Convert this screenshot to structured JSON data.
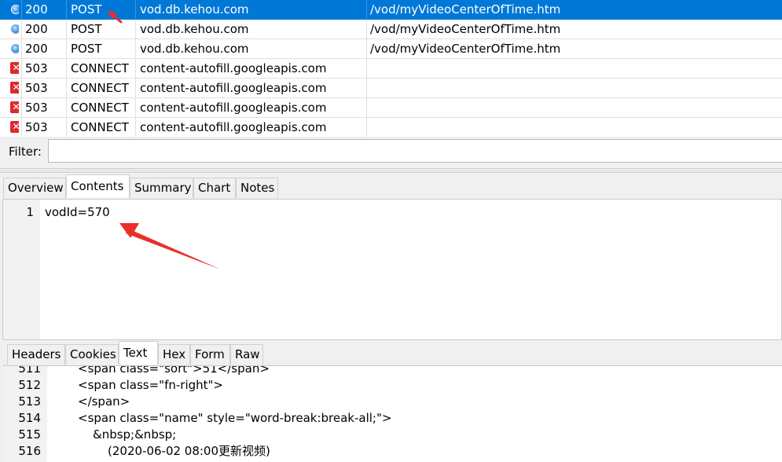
{
  "sessions": [
    {
      "icon": "globe-icon",
      "result": "200",
      "protocol": "POST",
      "host": "vod.db.kehou.com",
      "url": "/vod/myVideoCenterOfTime.htm",
      "selected": true
    },
    {
      "icon": "globe-icon",
      "result": "200",
      "protocol": "POST",
      "host": "vod.db.kehou.com",
      "url": "/vod/myVideoCenterOfTime.htm",
      "selected": false
    },
    {
      "icon": "globe-icon",
      "result": "200",
      "protocol": "POST",
      "host": "vod.db.kehou.com",
      "url": "/vod/myVideoCenterOfTime.htm",
      "selected": false
    },
    {
      "icon": "error-icon",
      "result": "503",
      "protocol": "CONNECT",
      "host": "content-autofill.googleapis.com",
      "url": "",
      "selected": false
    },
    {
      "icon": "error-icon",
      "result": "503",
      "protocol": "CONNECT",
      "host": "content-autofill.googleapis.com",
      "url": "",
      "selected": false
    },
    {
      "icon": "error-icon",
      "result": "503",
      "protocol": "CONNECT",
      "host": "content-autofill.googleapis.com",
      "url": "",
      "selected": false
    },
    {
      "icon": "error-icon",
      "result": "503",
      "protocol": "CONNECT",
      "host": "content-autofill.googleapis.com",
      "url": "",
      "selected": false
    }
  ],
  "filter": {
    "label": "Filter:",
    "value": ""
  },
  "request_tabs": [
    "Overview",
    "Contents",
    "Summary",
    "Chart",
    "Notes"
  ],
  "request_active_tab": "Contents",
  "request_body": {
    "line_number": "1",
    "text": "vodId=570"
  },
  "response_tabs": [
    "Headers",
    "Cookies",
    "Text",
    "Hex",
    "Form",
    "Raw"
  ],
  "response_active_tab": "Text",
  "response_lines": [
    {
      "num": "511",
      "text": "<span class=\"sort\">51</span>",
      "indent": 1
    },
    {
      "num": "512",
      "text": "<span class=\"fn-right\">",
      "indent": 1
    },
    {
      "num": "513",
      "text": "</span>",
      "indent": 1
    },
    {
      "num": "514",
      "text": "<span class=\"name\" style=\"word-break:break-all;\">",
      "indent": 1
    },
    {
      "num": "515",
      "text": "&nbsp;&nbsp;",
      "indent": 2
    },
    {
      "num": "516",
      "text": "(2020-06-02 08:00更新视频)",
      "indent": 3
    }
  ],
  "colors": {
    "selection": "#0078d7",
    "error": "#e0282d",
    "arrow": "#e8302a"
  }
}
